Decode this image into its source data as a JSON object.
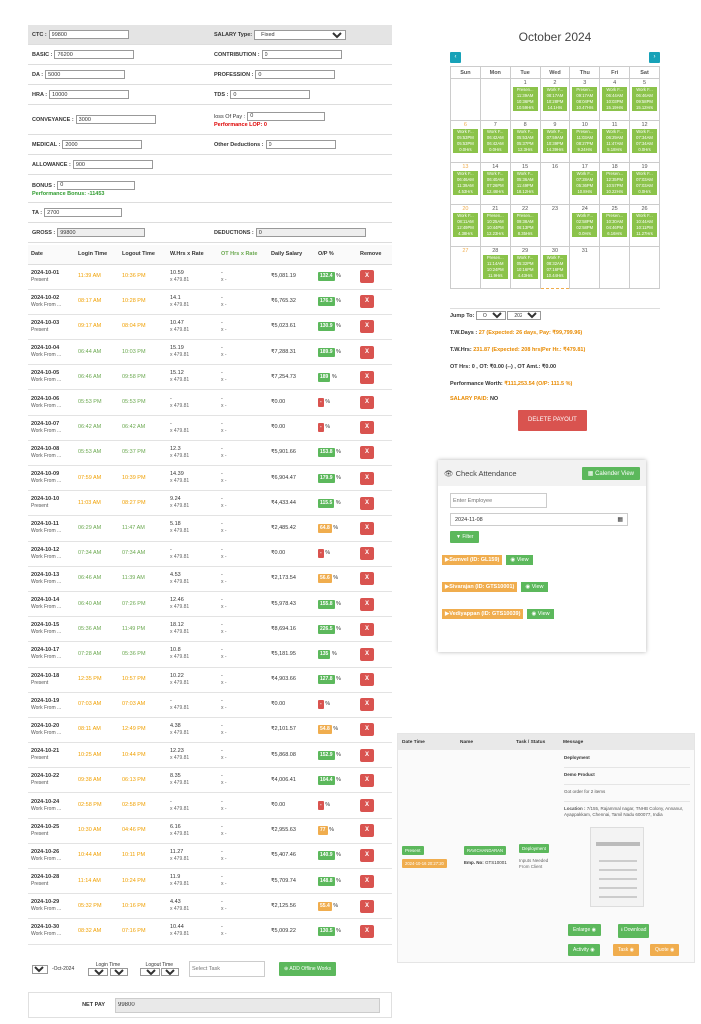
{
  "form": {
    "ctc_label": "CTC :",
    "ctc_value": "99800",
    "salary_type_label": "SALARY Type:",
    "salary_type_value": "Fixed",
    "basic_label": "BASIC :",
    "basic_value": "76200",
    "contribution_label": "CONTRIBUTION :",
    "contribution_value": "0",
    "da_label": "DA :",
    "da_value": "5000",
    "profession_label": "PROFESSION :",
    "profession_value": "0",
    "hra_label": "HRA :",
    "hra_value": "10000",
    "tds_label": "TDS :",
    "tds_value": "0",
    "conveyance_label": "CONVEYANCE :",
    "conveyance_value": "3000",
    "loss_of_pay_label": "loss Of Pay :",
    "loss_of_pay_value": "0",
    "performance_lop": "Performance LOP: 0",
    "medical_label": "MEDICAL :",
    "medical_value": "2000",
    "other_deductions_label": "Other Deductions :",
    "other_deductions_value": "0",
    "allowance_label": "ALLOWANCE :",
    "allowance_value": "900",
    "bonus_label": "BONUS :",
    "bonus_value": "0",
    "performance_bonus": "Performance Bonus: -11453",
    "ta_label": "TA :",
    "ta_value": "2700",
    "gross_label": "GROSS :",
    "gross_value": "99800",
    "deductions_label": "DEDUCTIONS :",
    "deductions_value": "0"
  },
  "table": {
    "headers": [
      "Date",
      "Login Time",
      "Logout Time",
      "W.Hrs x Rate",
      "OT Hrs x Rate",
      "Daily Salary",
      "O/P %",
      "Remove"
    ],
    "rows": [
      {
        "date": "2024-10-01",
        "status": "Present",
        "login": "11:39 AM",
        "logout": "10:36 PM",
        "whrs": "10.59",
        "rate": "x 479.81",
        "ot": "-",
        "otrate": "x -",
        "salary": "₹5,081.19",
        "op": "132.4",
        "opc": "green",
        "remove": "X",
        "lg": false
      },
      {
        "date": "2024-10-02",
        "status": "Work From ...",
        "login": "08:17 AM",
        "logout": "10:28 PM",
        "whrs": "14.1",
        "rate": "x 479.81",
        "ot": "-",
        "otrate": "x -",
        "salary": "₹6,765.32",
        "op": "176.3",
        "opc": "green",
        "remove": "X",
        "lg": false
      },
      {
        "date": "2024-10-03",
        "status": "Present",
        "login": "09:17 AM",
        "logout": "08:04 PM",
        "whrs": "10.47",
        "rate": "x 479.81",
        "ot": "-",
        "otrate": "x -",
        "salary": "₹5,023.61",
        "op": "130.9",
        "opc": "green",
        "remove": "X",
        "lg": false
      },
      {
        "date": "2024-10-04",
        "status": "Work From ...",
        "login": "06:44 AM",
        "logout": "10:03 PM",
        "whrs": "15.19",
        "rate": "x 479.81",
        "ot": "-",
        "otrate": "x -",
        "salary": "₹7,288.31",
        "op": "189.9",
        "opc": "green",
        "remove": "X",
        "lg": true
      },
      {
        "date": "2024-10-05",
        "status": "Work From ...",
        "login": "06:46 AM",
        "logout": "09:58 PM",
        "whrs": "15.12",
        "rate": "x 479.81",
        "ot": "-",
        "otrate": "x -",
        "salary": "₹7,254.73",
        "op": "189",
        "opc": "green",
        "remove": "X",
        "lg": true
      },
      {
        "date": "2024-10-06",
        "status": "Work From ...",
        "login": "05:53 PM",
        "logout": "05:53 PM",
        "whrs": "-",
        "rate": "x 479.81",
        "ot": "-",
        "otrate": "x -",
        "salary": "₹0.00",
        "op": "-",
        "opc": "red",
        "remove": "X",
        "lg": true
      },
      {
        "date": "2024-10-07",
        "status": "Work From ...",
        "login": "06:42 AM",
        "logout": "06:42 AM",
        "whrs": "-",
        "rate": "x 479.81",
        "ot": "-",
        "otrate": "x -",
        "salary": "₹0.00",
        "op": "-",
        "opc": "red",
        "remove": "X",
        "lg": true
      },
      {
        "date": "2024-10-08",
        "status": "Work From ...",
        "login": "05:53 AM",
        "logout": "05:37 PM",
        "whrs": "12.3",
        "rate": "x 479.81",
        "ot": "-",
        "otrate": "x -",
        "salary": "₹5,901.66",
        "op": "153.8",
        "opc": "green",
        "remove": "X",
        "lg": true
      },
      {
        "date": "2024-10-09",
        "status": "Work From ...",
        "login": "07:59 AM",
        "logout": "10:39 PM",
        "whrs": "14.39",
        "rate": "x 479.81",
        "ot": "-",
        "otrate": "x -",
        "salary": "₹6,904.47",
        "op": "179.9",
        "opc": "green",
        "remove": "X",
        "lg": false
      },
      {
        "date": "2024-10-10",
        "status": "Present",
        "login": "11:03 AM",
        "logout": "08:27 PM",
        "whrs": "9.24",
        "rate": "x 479.81",
        "ot": "-",
        "otrate": "x -",
        "salary": "₹4,433.44",
        "op": "115.5",
        "opc": "green",
        "remove": "X",
        "lg": false
      },
      {
        "date": "2024-10-11",
        "status": "Work From ...",
        "login": "06:29 AM",
        "logout": "11:47 AM",
        "whrs": "5.18",
        "rate": "x 479.81",
        "ot": "-",
        "otrate": "x -",
        "salary": "₹2,485.42",
        "op": "64.8",
        "opc": "orange",
        "remove": "X",
        "lg": true
      },
      {
        "date": "2024-10-12",
        "status": "Work From ...",
        "login": "07:34 AM",
        "logout": "07:34 AM",
        "whrs": "-",
        "rate": "x 479.81",
        "ot": "-",
        "otrate": "x -",
        "salary": "₹0.00",
        "op": "-",
        "opc": "red",
        "remove": "X",
        "lg": true
      },
      {
        "date": "2024-10-13",
        "status": "Work From ...",
        "login": "06:46 AM",
        "logout": "11:39 AM",
        "whrs": "4.53",
        "rate": "x 479.81",
        "ot": "-",
        "otrate": "x -",
        "salary": "₹2,173.54",
        "op": "56.6",
        "opc": "orange",
        "remove": "X",
        "lg": true
      },
      {
        "date": "2024-10-14",
        "status": "Work From ...",
        "login": "06:40 AM",
        "logout": "07:26 PM",
        "whrs": "12.46",
        "rate": "x 479.81",
        "ot": "-",
        "otrate": "x -",
        "salary": "₹5,978.43",
        "op": "155.8",
        "opc": "green",
        "remove": "X",
        "lg": true
      },
      {
        "date": "2024-10-15",
        "status": "Work From ...",
        "login": "05:36 AM",
        "logout": "11:49 PM",
        "whrs": "18.12",
        "rate": "x 479.81",
        "ot": "-",
        "otrate": "x -",
        "salary": "₹8,694.16",
        "op": "226.5",
        "opc": "green",
        "remove": "X",
        "lg": true
      },
      {
        "date": "2024-10-17",
        "status": "Work From ...",
        "login": "07:28 AM",
        "logout": "05:36 PM",
        "whrs": "10.8",
        "rate": "x 479.81",
        "ot": "-",
        "otrate": "x -",
        "salary": "₹5,181.95",
        "op": "135",
        "opc": "green",
        "remove": "X",
        "lg": true
      },
      {
        "date": "2024-10-18",
        "status": "Present",
        "login": "12:35 PM",
        "logout": "10:57 PM",
        "whrs": "10.22",
        "rate": "x 479.81",
        "ot": "-",
        "otrate": "x -",
        "salary": "₹4,903.66",
        "op": "127.8",
        "opc": "green",
        "remove": "X",
        "lg": false
      },
      {
        "date": "2024-10-19",
        "status": "Work From ...",
        "login": "07:03 AM",
        "logout": "07:03 AM",
        "whrs": "-",
        "rate": "x 479.81",
        "ot": "-",
        "otrate": "x -",
        "salary": "₹0.00",
        "op": "-",
        "opc": "red",
        "remove": "X",
        "lg": false
      },
      {
        "date": "2024-10-20",
        "status": "Work From ...",
        "login": "08:11 AM",
        "logout": "12:49 PM",
        "whrs": "4.38",
        "rate": "x 479.81",
        "ot": "-",
        "otrate": "x -",
        "salary": "₹2,101.57",
        "op": "54.8",
        "opc": "orange",
        "remove": "X",
        "lg": false
      },
      {
        "date": "2024-10-21",
        "status": "Present",
        "login": "10:25 AM",
        "logout": "10:44 PM",
        "whrs": "12.23",
        "rate": "x 479.81",
        "ot": "-",
        "otrate": "x -",
        "salary": "₹5,868.08",
        "op": "152.9",
        "opc": "green",
        "remove": "X",
        "lg": false
      },
      {
        "date": "2024-10-22",
        "status": "Present",
        "login": "09:38 AM",
        "logout": "06:13 PM",
        "whrs": "8.35",
        "rate": "x 479.81",
        "ot": "-",
        "otrate": "x -",
        "salary": "₹4,006.41",
        "op": "104.4",
        "opc": "green",
        "remove": "X",
        "lg": false
      },
      {
        "date": "2024-10-24",
        "status": "Work From ...",
        "login": "02:58 PM",
        "logout": "02:58 PM",
        "whrs": "-",
        "rate": "x 479.81",
        "ot": "-",
        "otrate": "x -",
        "salary": "₹0.00",
        "op": "-",
        "opc": "red",
        "remove": "X",
        "lg": false
      },
      {
        "date": "2024-10-25",
        "status": "Present",
        "login": "10:30 AM",
        "logout": "04:46 PM",
        "whrs": "6.16",
        "rate": "x 479.81",
        "ot": "-",
        "otrate": "x -",
        "salary": "₹2,955.63",
        "op": "77",
        "opc": "orange",
        "remove": "X",
        "lg": false
      },
      {
        "date": "2024-10-26",
        "status": "Work From ...",
        "login": "10:44 AM",
        "logout": "10:11 PM",
        "whrs": "11.27",
        "rate": "x 479.81",
        "ot": "-",
        "otrate": "x -",
        "salary": "₹5,407.46",
        "op": "140.9",
        "opc": "green",
        "remove": "X",
        "lg": false
      },
      {
        "date": "2024-10-28",
        "status": "Present",
        "login": "11:14 AM",
        "logout": "10:24 PM",
        "whrs": "11.9",
        "rate": "x 479.81",
        "ot": "-",
        "otrate": "x -",
        "salary": "₹5,709.74",
        "op": "148.8",
        "opc": "green",
        "remove": "X",
        "lg": false
      },
      {
        "date": "2024-10-29",
        "status": "Work From ...",
        "login": "05:32 PM",
        "logout": "10:16 PM",
        "whrs": "4.43",
        "rate": "x 479.81",
        "ot": "-",
        "otrate": "x -",
        "salary": "₹2,125.56",
        "op": "55.4",
        "opc": "orange",
        "remove": "X",
        "lg": false
      },
      {
        "date": "2024-10-30",
        "status": "Work From ...",
        "login": "08:32 AM",
        "logout": "07:16 PM",
        "whrs": "10.44",
        "rate": "x 479.81",
        "ot": "-",
        "otrate": "x -",
        "salary": "₹5,009.22",
        "op": "130.5",
        "opc": "green",
        "remove": "X",
        "lg": false
      }
    ]
  },
  "offline": {
    "day_value": "01",
    "month_text": "-Oct-2024",
    "login_label": "Login Time",
    "logout_label": "Logout Time",
    "hour_placeholder": "Hour",
    "min_placeholder": "Min",
    "task_placeholder": "Select Task",
    "add_label": "ADD Offline Works"
  },
  "netpay": {
    "label": "NET PAY",
    "value": "99800"
  },
  "calendar": {
    "title": "October 2024",
    "prev_icon": "‹",
    "next_icon": "›",
    "days": [
      "Sun",
      "Mon",
      "Tue",
      "Wed",
      "Thu",
      "Fri",
      "Sat"
    ],
    "weeks": [
      [
        {
          "d": "",
          "e": []
        },
        {
          "d": "",
          "e": []
        },
        {
          "d": "1",
          "e": [
            "Presen...",
            "11:39AM",
            "10:36PM",
            "10.59Hrs"
          ]
        },
        {
          "d": "2",
          "e": [
            "Work F...",
            "08:17AM",
            "10:28PM",
            "14.1Hrs"
          ]
        },
        {
          "d": "3",
          "e": [
            "Presen...",
            "09:17AM",
            "08:04PM",
            "10.47Hrs"
          ]
        },
        {
          "d": "4",
          "e": [
            "Work F...",
            "06:44AM",
            "10:03PM",
            "15.19Hrs"
          ]
        },
        {
          "d": "5",
          "e": [
            "Work F...",
            "06:46AM",
            "09:58PM",
            "15.12Hrs"
          ]
        }
      ],
      [
        {
          "d": "6",
          "e": [
            "Work F...",
            "05:53PM",
            "05:53PM",
            "0.0Hrs"
          ]
        },
        {
          "d": "7",
          "e": [
            "Work F...",
            "06:42AM",
            "06:42AM",
            "0.0Hrs"
          ]
        },
        {
          "d": "8",
          "e": [
            "Work F...",
            "05:53AM",
            "05:37PM",
            "12.3Hrs"
          ]
        },
        {
          "d": "9",
          "e": [
            "Work F...",
            "07:59AM",
            "10:39PM",
            "14.39Hrs"
          ]
        },
        {
          "d": "10",
          "e": [
            "Presen...",
            "11:03AM",
            "08:27PM",
            "9.24Hrs"
          ]
        },
        {
          "d": "11",
          "e": [
            "Work F...",
            "06:29AM",
            "11:47AM",
            "5.18Hrs"
          ]
        },
        {
          "d": "12",
          "e": [
            "Work F...",
            "07:34AM",
            "07:34AM",
            "0.0Hrs"
          ]
        }
      ],
      [
        {
          "d": "13",
          "e": [
            "Work F...",
            "06:46AM",
            "11:39AM",
            "4.53Hrs"
          ]
        },
        {
          "d": "14",
          "e": [
            "Work F...",
            "06:40AM",
            "07:26PM",
            "12.46Hrs"
          ]
        },
        {
          "d": "15",
          "e": [
            "Work F...",
            "05:36AM",
            "11:49PM",
            "18.12Hrs"
          ]
        },
        {
          "d": "16",
          "e": []
        },
        {
          "d": "17",
          "e": [
            "Work F...",
            "07:28AM",
            "05:36PM",
            "10.8Hrs"
          ]
        },
        {
          "d": "18",
          "e": [
            "Presen...",
            "12:35PM",
            "10:57PM",
            "10.22Hrs"
          ]
        },
        {
          "d": "19",
          "e": [
            "Work F...",
            "07:03AM",
            "07:03AM",
            "0.0Hrs"
          ]
        }
      ],
      [
        {
          "d": "20",
          "e": [
            "Work F...",
            "08:11AM",
            "12:49PM",
            "4.38Hrs"
          ]
        },
        {
          "d": "21",
          "e": [
            "Presen...",
            "10:25AM",
            "10:44PM",
            "12.23Hrs"
          ]
        },
        {
          "d": "22",
          "e": [
            "Presen...",
            "09:38AM",
            "06:13PM",
            "8.35Hrs"
          ]
        },
        {
          "d": "23",
          "e": []
        },
        {
          "d": "24",
          "e": [
            "Work F...",
            "02:58PM",
            "02:58PM",
            "0.0Hrs"
          ]
        },
        {
          "d": "25",
          "e": [
            "Presen...",
            "10:30AM",
            "04:46PM",
            "6.16Hrs"
          ]
        },
        {
          "d": "26",
          "e": [
            "Work F...",
            "10:44AM",
            "10:11PM",
            "11.27Hrs"
          ]
        }
      ],
      [
        {
          "d": "27",
          "e": []
        },
        {
          "d": "28",
          "e": [
            "Presen...",
            "11:14AM",
            "10:24PM",
            "11.9Hrs"
          ]
        },
        {
          "d": "29",
          "e": [
            "Work F...",
            "05:32PM",
            "10:16PM",
            "4.43Hrs"
          ]
        },
        {
          "d": "30",
          "e": [
            "Work F...",
            "08:32AM",
            "07:16PM",
            "10.44Hrs"
          ]
        },
        {
          "d": "31",
          "e": []
        },
        {
          "d": "",
          "e": []
        },
        {
          "d": "",
          "e": []
        }
      ]
    ]
  },
  "summary": {
    "jump_label": "Jump To:",
    "month_value": "Oct",
    "year_value": "2024",
    "tw_days_label": "T.W.Days :",
    "tw_days_value": "27",
    "expected_days": "(Expected: 26 days, Pay: ₹99,799.96)",
    "tw_hrs_label": "T.W.Hrs:",
    "tw_hrs_value": "231.87",
    "expected_hrs": "(Expected: 208 hrs|Per Hr.: ₹479.81)",
    "ot_line": "OT Hrs: 0 , OT: ₹0.00 (--) , OT Amt.: ₹0.00",
    "perf_label": "Performance Worth:",
    "perf_value": "₹111,253.54 (O/P: 111.5 %)",
    "salary_paid": "SALARY PAID:",
    "salary_paid_value": "NO",
    "delete_label": "DELETE PAYOUT"
  },
  "check": {
    "title": "Check Attendance",
    "calendar_view": "Calender View",
    "employee_placeholder": "Enter Employee",
    "date_value": "2024-11-08",
    "filter_label": "Filter",
    "employees": [
      {
        "name": "Samvel (ID: GL159)",
        "view": "View"
      },
      {
        "name": "Sivarajan (ID: GTS10001)",
        "view": "View"
      },
      {
        "name": "Vediyappan (ID: GTS10039)",
        "view": "View"
      }
    ]
  },
  "task": {
    "col_datetime": "Date Time",
    "col_name": "Name",
    "col_task": "Task / Status",
    "col_message": "Message",
    "status_badge": "Present",
    "datetime_badge": "2024-10-16 20:27:20",
    "name_badge": "RAVICHANDARAN",
    "emp_no_label": "Emp. No:",
    "emp_no_value": "GTS10001",
    "task_badge": "Deployment",
    "task_note": "Inputs Needed From Client",
    "msg_title": "Deployment",
    "msg_product": "Demo Product",
    "msg_order": "Got order for 2 items",
    "msg_location_label": "Location :",
    "msg_location": "7/155, Rajammal nagar, TNHB Colony, Annanur, Ayappakkam, Chennai, Tamil Nadu 600077, India",
    "enlarge": "Enlarge",
    "download": "Download",
    "activity": "Activity",
    "task_btn": "Task",
    "quote": "Quote"
  },
  "colors": {
    "green": "#5cb85c",
    "orange": "#f0ad4e",
    "red": "#d9534f",
    "teal": "#17a2b8",
    "event": "#8bc34a"
  }
}
